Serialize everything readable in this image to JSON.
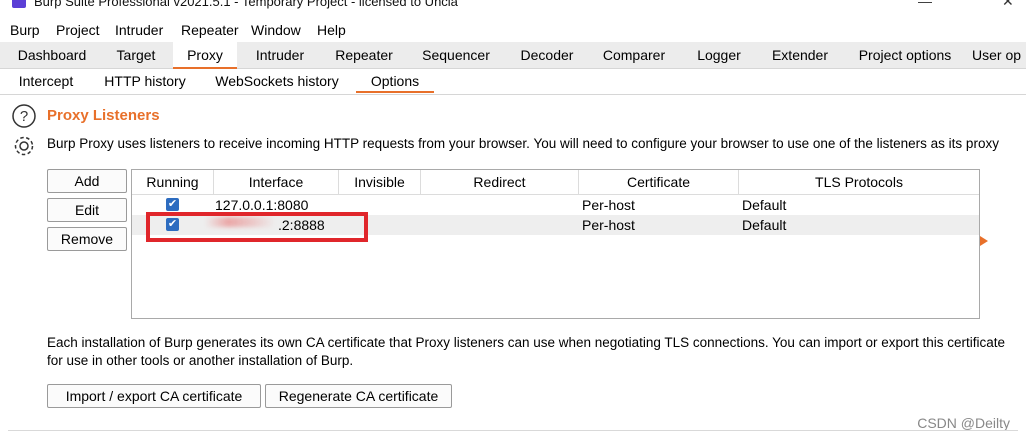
{
  "window": {
    "title": "Burp Suite Professional v2021.5.1 - Temporary Project - licensed to Uncia",
    "minimize": "—",
    "close": "✕"
  },
  "menubar": [
    "Burp",
    "Project",
    "Intruder",
    "Repeater",
    "Window",
    "Help"
  ],
  "tabs": [
    {
      "label": "Dashboard"
    },
    {
      "label": "Target"
    },
    {
      "label": "Proxy",
      "active": true
    },
    {
      "label": "Intruder"
    },
    {
      "label": "Repeater"
    },
    {
      "label": "Sequencer"
    },
    {
      "label": "Decoder"
    },
    {
      "label": "Comparer"
    },
    {
      "label": "Logger"
    },
    {
      "label": "Extender"
    },
    {
      "label": "Project options"
    },
    {
      "label": "User op"
    }
  ],
  "subtabs": [
    {
      "label": "Intercept"
    },
    {
      "label": "HTTP history"
    },
    {
      "label": "WebSockets history"
    },
    {
      "label": "Options",
      "active": true
    }
  ],
  "section": {
    "title": "Proxy Listeners",
    "description": "Burp Proxy uses listeners to receive incoming HTTP requests from your browser. You will need to configure your browser to use one of the listeners as its proxy"
  },
  "side_buttons": {
    "add": "Add",
    "edit": "Edit",
    "remove": "Remove"
  },
  "table": {
    "headers": [
      "Running",
      "Interface",
      "Invisible",
      "Redirect",
      "Certificate",
      "TLS Protocols"
    ],
    "rows": [
      {
        "running": true,
        "interface": "127.0.0.1:8080",
        "invisible": "",
        "redirect": "",
        "certificate": "Per-host",
        "tls": "Default"
      },
      {
        "running": true,
        "interface": ".2:8888",
        "invisible": "",
        "redirect": "",
        "certificate": "Per-host",
        "tls": "Default"
      }
    ]
  },
  "ca": {
    "text": "Each installation of Burp generates its own CA certificate that Proxy listeners can use when negotiating TLS connections. You can import or export this certificate for use in other tools or another installation of Burp.",
    "import_export": "Import / export CA certificate",
    "regenerate": "Regenerate CA certificate"
  },
  "watermark": "CSDN @Deilty",
  "colors": {
    "accent": "#e8702a",
    "annotation": "#e0262b",
    "checkbox": "#2d6cc0"
  },
  "icons": {
    "help": "question-circle-icon",
    "settings": "gear-icon",
    "checkbox": "checkmark-icon"
  }
}
